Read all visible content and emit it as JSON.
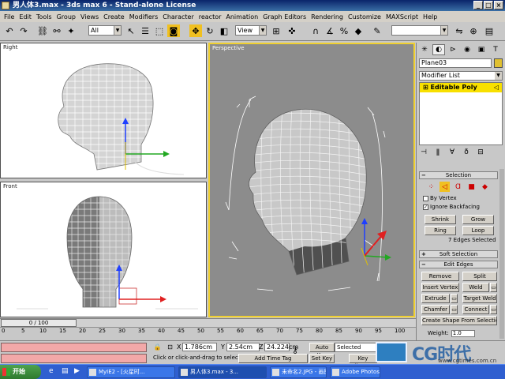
{
  "window": {
    "title": "男人体3.max - 3ds max 6 - Stand-alone License"
  },
  "menu": [
    "File",
    "Edit",
    "Tools",
    "Group",
    "Views",
    "Create",
    "Modifiers",
    "Character",
    "reactor",
    "Animation",
    "Graph Editors",
    "Rendering",
    "Customize",
    "MAXScript",
    "Help"
  ],
  "toolbar": {
    "selection_filter": "All",
    "reference_coord": "View",
    "named_selection": ""
  },
  "viewports": {
    "right": "Right",
    "front": "Front",
    "perspective": "Perspective"
  },
  "command_panel": {
    "object_name": "Plane03",
    "modifier_list": "Modifier List",
    "stack_item": "Editable Poly",
    "selection": {
      "header": "Selection",
      "by_vertex": "By Vertex",
      "ignore_backfacing": "Ignore Backfacing",
      "shrink": "Shrink",
      "grow": "Grow",
      "ring": "Ring",
      "loop": "Loop",
      "status": "7 Edges Selected"
    },
    "soft_selection": "Soft Selection",
    "edit_edges": {
      "header": "Edit Edges",
      "remove": "Remove",
      "split": "Split",
      "insert_vertex": "Insert Vertex",
      "weld": "Weld",
      "extrude": "Extrude",
      "target_weld": "Target Weld",
      "chamfer": "Chamfer",
      "connect": "Connect",
      "create_shape": "Create Shape From Selection",
      "weight_label": "Weight:",
      "weight_value": "1.0"
    }
  },
  "timeline": {
    "frame": "0 / 100",
    "ticks": [
      "0",
      "5",
      "10",
      "15",
      "20",
      "25",
      "30",
      "35",
      "40",
      "45",
      "50",
      "55",
      "60",
      "65",
      "70",
      "75",
      "80",
      "85",
      "90",
      "95",
      "100"
    ]
  },
  "status": {
    "x_label": "X",
    "x_value": "1.786cm",
    "y_label": "Y",
    "y_value": "2.54cm",
    "z_label": "Z",
    "z_value": "24.224cm",
    "prompt": "Click or click-and-drag to select obj",
    "add_time_tag": "Add Time Tag",
    "auto_key": "Auto Key",
    "selected": "Selected",
    "set_key": "Set Key",
    "key_filters": "Key Filters..."
  },
  "watermark": {
    "brand": "CG时代",
    "url": "www.cgtimes.com.cn"
  },
  "taskbar": {
    "start": "开始",
    "tasks": [
      "MyIE2 - [火星时...",
      "男人体3.max - 3...",
      "未命名2.JPG - 画图",
      "Adobe Photoshop"
    ]
  }
}
